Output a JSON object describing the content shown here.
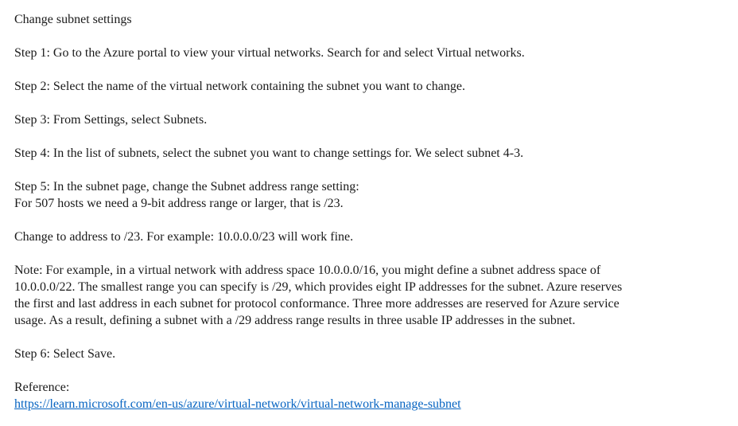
{
  "title": "Change subnet settings",
  "steps": [
    "Step 1: Go to the Azure portal to view your virtual networks. Search for and select Virtual networks.",
    "Step 2: Select the name of the virtual network containing the subnet you want to change.",
    "Step 3: From Settings, select Subnets.",
    "Step 4: In the list of subnets, select the subnet you want to change settings for. We select subnet 4-3."
  ],
  "step5": {
    "line1": "Step 5: In the subnet page, change the Subnet address range setting:",
    "line2": "For 507 hosts we need a 9-bit address range or larger, that is /23."
  },
  "change_text": "Change to address to /23. For example: 10.0.0.0/23 will work fine.",
  "note_lines": [
    "Note: For example, in a virtual network with address space 10.0.0.0/16, you might define a subnet address space of",
    "10.0.0.0/22. The smallest range you can specify is /29, which provides eight IP addresses for the subnet. Azure reserves",
    "the first and last address in each subnet for protocol conformance. Three more addresses are reserved for Azure service",
    "usage. As a result, defining a subnet with a /29 address range results in three usable IP addresses in the subnet."
  ],
  "step6": "Step 6: Select Save.",
  "reference": {
    "label": "Reference:",
    "url": "https://learn.microsoft.com/en-us/azure/virtual-network/virtual-network-manage-subnet"
  },
  "colors": {
    "text": "#1a1a1a",
    "link": "#0563c1"
  }
}
